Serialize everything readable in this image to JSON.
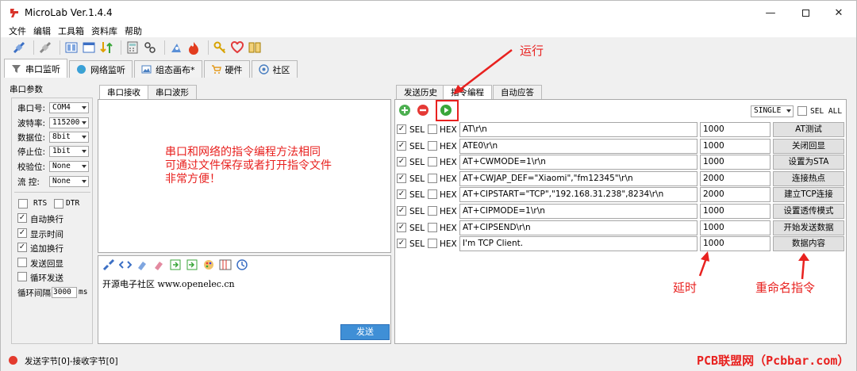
{
  "window": {
    "title": "MicroLab Ver.1.4.4"
  },
  "menu": [
    "文件",
    "编辑",
    "工具箱",
    "资料库",
    "帮助"
  ],
  "main_tabs": [
    {
      "label": "串口监听",
      "icon": "funnel-icon"
    },
    {
      "label": "网络监听",
      "icon": "globe-icon"
    },
    {
      "label": "组态画布*",
      "icon": "canvas-icon"
    },
    {
      "label": "硬件",
      "icon": "cart-icon"
    },
    {
      "label": "社区",
      "icon": "community-icon"
    }
  ],
  "serial": {
    "group_title": "串口参数",
    "fields": [
      {
        "label": "串口号:",
        "value": "COM4"
      },
      {
        "label": "波特率:",
        "value": "115200"
      },
      {
        "label": "数据位:",
        "value": "8bit"
      },
      {
        "label": "停止位:",
        "value": "1bit"
      },
      {
        "label": "校验位:",
        "value": "None"
      },
      {
        "label": "流  控:",
        "value": "None"
      }
    ],
    "rts": "RTS",
    "dtr": "DTR",
    "options": [
      {
        "label": "自动换行",
        "checked": true
      },
      {
        "label": "显示时间",
        "checked": true
      },
      {
        "label": "追加换行",
        "checked": true
      },
      {
        "label": "发送回显",
        "checked": false
      },
      {
        "label": "循环发送",
        "checked": false
      }
    ],
    "interval_label": "循环间隔",
    "interval_value": "3000",
    "interval_unit": "ms"
  },
  "receive_tabs": [
    "串口接收",
    "串口波形"
  ],
  "send": {
    "text": "开源电子社区 www.openelec.cn",
    "button": "发送"
  },
  "right_tabs": [
    "发送历史",
    "指令编程",
    "自动应答"
  ],
  "mode": {
    "value": "SINGLE",
    "sel_all_label": "SEL ALL"
  },
  "col_labels": {
    "sel": "SEL",
    "hex": "HEX"
  },
  "commands": [
    {
      "cmd": "AT\\r\\n",
      "delay": "1000",
      "name": "AT测试",
      "sel": true
    },
    {
      "cmd": "ATE0\\r\\n",
      "delay": "1000",
      "name": "关闭回显",
      "sel": true
    },
    {
      "cmd": "AT+CWMODE=1\\r\\n",
      "delay": "1000",
      "name": "设置为STA",
      "sel": true
    },
    {
      "cmd": "AT+CWJAP_DEF=\"Xiaomi\",\"fm12345\"\\r\\n",
      "delay": "2000",
      "name": "连接热点",
      "sel": true
    },
    {
      "cmd": "AT+CIPSTART=\"TCP\",\"192.168.31.238\",8234\\r\\n",
      "delay": "2000",
      "name": "建立TCP连接",
      "sel": true
    },
    {
      "cmd": "AT+CIPMODE=1\\r\\n",
      "delay": "1000",
      "name": "设置透传模式",
      "sel": true
    },
    {
      "cmd": "AT+CIPSEND\\r\\n",
      "delay": "1000",
      "name": "开始发送数据",
      "sel": true
    },
    {
      "cmd": "I'm TCP Client.",
      "delay": "1000",
      "name": "数据内容",
      "sel": true
    }
  ],
  "annotations": {
    "run": "运行",
    "note_lines": [
      "串口和网络的指令编程方法相同",
      "可通过文件保存或者打开指令文件",
      "非常方便！"
    ],
    "delay": "延时",
    "rename": "重命名指令"
  },
  "status": {
    "text": "发送字节[0]-接收字节[0]"
  },
  "watermark": "PCB联盟网（Pcbbar.com）",
  "colors": {
    "accent_red": "#e8211f",
    "run_green": "#3aa63a",
    "add_green": "#4caf50",
    "remove_red": "#e53935"
  }
}
